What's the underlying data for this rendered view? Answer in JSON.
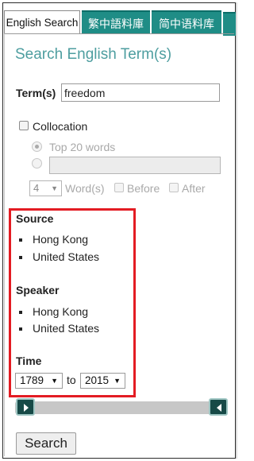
{
  "tabs": [
    {
      "label": "English Search",
      "active": true
    },
    {
      "label": "繁中語料庫",
      "active": false
    },
    {
      "label": "简中语料库",
      "active": false
    }
  ],
  "colors": {
    "teal": "#1f8d86",
    "title": "#4e9ea0",
    "highlight": "#e31c23",
    "handle": "#174a47"
  },
  "form": {
    "title": "Search English Term(s)",
    "term_label": "Term(s)",
    "term_value": "freedom",
    "collocation_label": "Collocation",
    "top_words_label": "Top 20 words",
    "window_select_value": "4",
    "words_label": "Word(s)",
    "before_label": "Before",
    "after_label": "After"
  },
  "filters": {
    "source_heading": "Source",
    "source_items": [
      "Hong Kong",
      "United States"
    ],
    "speaker_heading": "Speaker",
    "speaker_items": [
      "Hong Kong",
      "United States"
    ],
    "time_heading": "Time",
    "time_from": "1789",
    "time_to_label": "to",
    "time_to": "2015"
  },
  "search_button": "Search"
}
